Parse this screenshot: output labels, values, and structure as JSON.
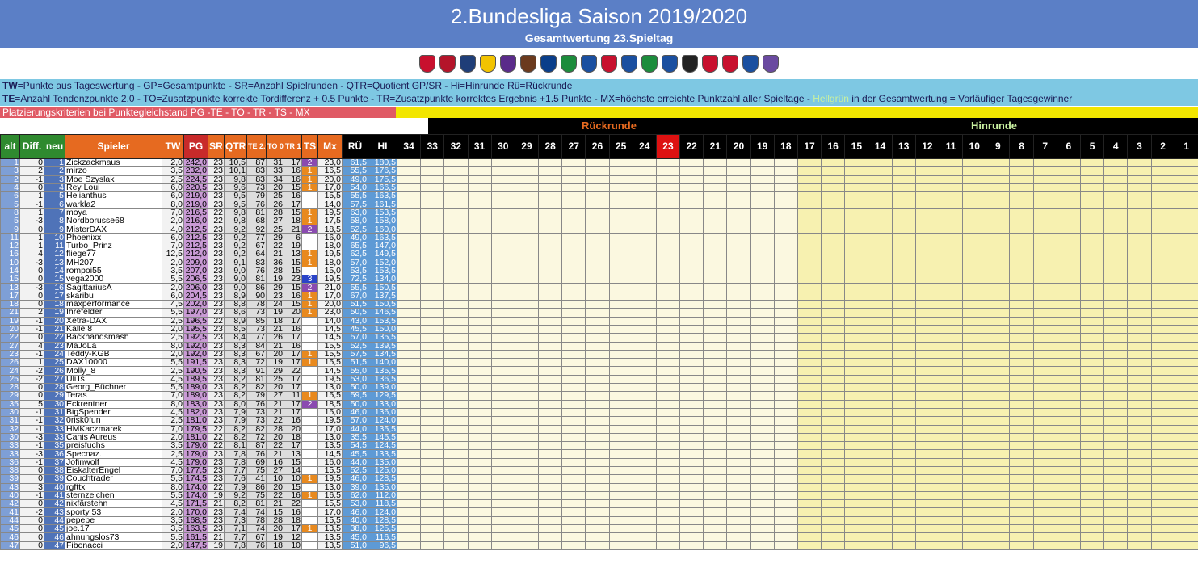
{
  "title": "2.Bundesliga Saison 2019/2020",
  "subtitle": "Gesamtwertung 23.Spieltag",
  "legend_line1": "=Punkte aus Tageswertung - GP=Gesamtpunkte - SR=Anzahl Spielrunden - QTR=Quotient GP/SR - Hi=Hinrunde Rü=Rückrunde",
  "legend_line1_prefix": "TW",
  "legend_line2": "=Anzahl Tendenzpunkte 2.0 - TO=Zusatzpunkte korrekte Tordifferenz + 0.5 Punkte - TR=Zusatzpunkte korrektes Ergebnis +1.5 Punkte - MX=höchste erreichte Punktzahl aller Spieltage - ",
  "legend_line2_prefix": "TE",
  "legend_green": "Hellgrün",
  "legend_tail": " in der Gesamtwertung = Vorläufiger Tagesgewinner",
  "criteria": "Platzierungskriterien bei Punktegleichstand  PG  -TE - TO - TR - TS - MX",
  "section_rueck": "Rückrunde",
  "section_hin": "Hinrunde",
  "headers": {
    "alt": "alt",
    "diff": "Diff.",
    "neu": "neu",
    "spieler": "Spieler",
    "tw": "TW",
    "pg": "PG",
    "sr": "SR",
    "qtr": "QTR",
    "te": "TE 2.0",
    "to": "TO 0.5",
    "tr": "TR 1.5",
    "ts": "TS",
    "mx": "Mx",
    "ru": "RÜ",
    "hi": "HI",
    "rounds_rueck": [
      "34",
      "33",
      "32",
      "31",
      "30",
      "29",
      "28",
      "27",
      "26",
      "25",
      "24",
      "23",
      "22",
      "21",
      "20",
      "19",
      "18"
    ],
    "rounds_hin": [
      "17",
      "16",
      "15",
      "14",
      "13",
      "12",
      "11",
      "10",
      "9",
      "8",
      "7",
      "6",
      "5",
      "4",
      "3",
      "2",
      "1"
    ]
  },
  "team_logos": [
    "1. FC Heidenheim",
    "1. FC Nürnberg",
    "Arminia Bielefeld",
    "Dynamo Dresden",
    "Erzgebirge Aue",
    "FC St. Pauli",
    "Hamburger SV",
    "Hannover 96",
    "Holstein Kiel",
    "Jahn Regensburg",
    "Karlsruher SC",
    "SpVgg Greuther Fürth",
    "SV Darmstadt 98",
    "SV Sandhausen",
    "SV Wehen Wiesbaden",
    "VfB Stuttgart",
    "VfL Bochum",
    "VfL Osnabrück"
  ],
  "rows": [
    [
      "1",
      "0",
      "1",
      "Zickzackmaus",
      "2,0",
      "242,0",
      "23",
      "10,5",
      "87",
      "31",
      "17",
      "2",
      "23,0",
      "61,5",
      "180,5"
    ],
    [
      "3",
      "2",
      "2",
      "mirzo",
      "3,5",
      "232,0",
      "23",
      "10,1",
      "83",
      "33",
      "16",
      "1",
      "16,5",
      "55,5",
      "176,5"
    ],
    [
      "2",
      "-1",
      "3",
      "Moe Szyslak",
      "2,5",
      "224,5",
      "23",
      "9,8",
      "83",
      "34",
      "16",
      "1",
      "20,0",
      "49,0",
      "175,5"
    ],
    [
      "4",
      "0",
      "4",
      "Rey Loui",
      "6,0",
      "220,5",
      "23",
      "9,6",
      "73",
      "20",
      "15",
      "1",
      "17,0",
      "54,0",
      "166,5"
    ],
    [
      "6",
      "1",
      "5",
      "Helianthus",
      "6,0",
      "219,0",
      "23",
      "9,5",
      "79",
      "25",
      "16",
      "",
      "15,5",
      "55,5",
      "163,5"
    ],
    [
      "5",
      "-1",
      "6",
      "warkla2",
      "8,0",
      "219,0",
      "23",
      "9,5",
      "76",
      "26",
      "17",
      "",
      "14,0",
      "57,5",
      "161,5"
    ],
    [
      "8",
      "1",
      "7",
      "moya",
      "7,0",
      "216,5",
      "22",
      "9,8",
      "81",
      "28",
      "15",
      "1",
      "19,5",
      "63,0",
      "153,5"
    ],
    [
      "5",
      "-3",
      "8",
      "Nordborusse68",
      "2,0",
      "216,0",
      "22",
      "9,8",
      "68",
      "27",
      "18",
      "1",
      "17,5",
      "58,0",
      "158,0"
    ],
    [
      "9",
      "0",
      "9",
      "MisterDAX",
      "4,0",
      "212,5",
      "23",
      "9,2",
      "92",
      "25",
      "21",
      "2",
      "18,5",
      "52,5",
      "160,0"
    ],
    [
      "11",
      "1",
      "10",
      "Phoenixx",
      "6,0",
      "212,5",
      "23",
      "9,2",
      "77",
      "29",
      "6",
      "",
      "16,0",
      "49,0",
      "163,5"
    ],
    [
      "12",
      "1",
      "11",
      "Turbo_Prinz",
      "7,0",
      "212,5",
      "23",
      "9,2",
      "67",
      "22",
      "19",
      "",
      "18,0",
      "65,5",
      "147,0"
    ],
    [
      "16",
      "4",
      "12",
      "fliege77",
      "12,5",
      "212,0",
      "23",
      "9,2",
      "64",
      "21",
      "13",
      "1",
      "19,5",
      "62,5",
      "149,5"
    ],
    [
      "10",
      "-3",
      "13",
      "MH207",
      "2,0",
      "209,0",
      "23",
      "9,1",
      "83",
      "36",
      "15",
      "1",
      "18,0",
      "57,0",
      "152,0"
    ],
    [
      "14",
      "0",
      "14",
      "rompoi55",
      "3,5",
      "207,0",
      "23",
      "9,0",
      "76",
      "28",
      "15",
      "",
      "15,0",
      "53,5",
      "153,5"
    ],
    [
      "15",
      "0",
      "15",
      "vega2000",
      "5,5",
      "206,5",
      "23",
      "9,0",
      "81",
      "19",
      "23",
      "3",
      "19,5",
      "72,5",
      "134,0"
    ],
    [
      "13",
      "-3",
      "16",
      "SagittariusA",
      "2,0",
      "206,0",
      "23",
      "9,0",
      "86",
      "29",
      "15",
      "2",
      "21,0",
      "55,5",
      "150,5"
    ],
    [
      "17",
      "0",
      "17",
      "skaribu",
      "6,0",
      "204,5",
      "23",
      "8,9",
      "90",
      "23",
      "16",
      "1",
      "17,0",
      "67,0",
      "137,5"
    ],
    [
      "18",
      "0",
      "18",
      "maxperformance",
      "4,5",
      "202,0",
      "23",
      "8,8",
      "78",
      "24",
      "15",
      "1",
      "20,0",
      "51,5",
      "150,5"
    ],
    [
      "21",
      "2",
      "19",
      "Ihrefelder",
      "5,5",
      "197,0",
      "23",
      "8,6",
      "73",
      "19",
      "20",
      "1",
      "23,0",
      "50,5",
      "146,5"
    ],
    [
      "19",
      "-1",
      "20",
      "Xetra-DAX",
      "2,5",
      "196,5",
      "22",
      "8,9",
      "85",
      "18",
      "17",
      "",
      "14,0",
      "43,0",
      "153,5"
    ],
    [
      "20",
      "-1",
      "21",
      "Kalle 8",
      "2,0",
      "195,5",
      "23",
      "8,5",
      "73",
      "21",
      "16",
      "",
      "14,5",
      "45,5",
      "150,0"
    ],
    [
      "22",
      "0",
      "22",
      "Backhandsmash",
      "2,5",
      "192,5",
      "23",
      "8,4",
      "77",
      "26",
      "17",
      "",
      "14,5",
      "57,0",
      "135,5"
    ],
    [
      "27",
      "4",
      "23",
      "MaJoLa",
      "8,0",
      "192,0",
      "23",
      "8,3",
      "84",
      "21",
      "16",
      "",
      "15,5",
      "52,5",
      "139,5"
    ],
    [
      "23",
      "-1",
      "24",
      "Teddy-KGB",
      "2,0",
      "192,0",
      "23",
      "8,3",
      "67",
      "20",
      "17",
      "1",
      "15,5",
      "57,5",
      "134,5"
    ],
    [
      "26",
      "1",
      "25",
      "DAX10000",
      "5,5",
      "191,5",
      "23",
      "8,3",
      "72",
      "19",
      "17",
      "1",
      "15,5",
      "51,5",
      "140,0"
    ],
    [
      "24",
      "-2",
      "26",
      "Molly_8",
      "2,5",
      "190,5",
      "23",
      "8,3",
      "91",
      "29",
      "22",
      "",
      "14,5",
      "55,0",
      "135,5"
    ],
    [
      "25",
      "-2",
      "27",
      "UliTs",
      "4,5",
      "189,5",
      "23",
      "8,2",
      "81",
      "25",
      "17",
      "",
      "19,5",
      "53,0",
      "136,5"
    ],
    [
      "28",
      "0",
      "28",
      "Georg_Büchner",
      "5,5",
      "189,0",
      "23",
      "8,2",
      "82",
      "20",
      "17",
      "",
      "13,0",
      "50,0",
      "139,0"
    ],
    [
      "29",
      "0",
      "29",
      "Teras",
      "7,0",
      "189,0",
      "23",
      "8,2",
      "79",
      "27",
      "11",
      "1",
      "15,5",
      "59,5",
      "129,5"
    ],
    [
      "35",
      "5",
      "30",
      "Eckrentner",
      "8,0",
      "183,0",
      "23",
      "8,0",
      "76",
      "21",
      "17",
      "2",
      "18,5",
      "50,0",
      "133,0"
    ],
    [
      "30",
      "-1",
      "31",
      "BigSpender",
      "4,5",
      "182,0",
      "23",
      "7,9",
      "73",
      "21",
      "17",
      "",
      "15,0",
      "46,0",
      "136,0"
    ],
    [
      "31",
      "-1",
      "32",
      "0risk0fun",
      "2,5",
      "181,0",
      "23",
      "7,9",
      "73",
      "22",
      "16",
      "",
      "19,5",
      "57,0",
      "124,0"
    ],
    [
      "32",
      "-1",
      "33",
      "HMKaczmarek",
      "7,0",
      "179,5",
      "22",
      "8,2",
      "82",
      "28",
      "20",
      "",
      "17,0",
      "44,0",
      "135,5"
    ],
    [
      "30",
      "-3",
      "33",
      "Canis Aureus",
      "2,0",
      "181,0",
      "22",
      "8,2",
      "72",
      "20",
      "18",
      "",
      "13,0",
      "35,5",
      "145,5"
    ],
    [
      "33",
      "-1",
      "35",
      "preisfuchs",
      "3,5",
      "179,0",
      "22",
      "8,1",
      "87",
      "22",
      "17",
      "",
      "13,5",
      "54,5",
      "124,5"
    ],
    [
      "33",
      "-3",
      "36",
      "Specnaz.",
      "2,5",
      "179,0",
      "23",
      "7,8",
      "76",
      "21",
      "13",
      "",
      "14,5",
      "45,5",
      "133,5"
    ],
    [
      "36",
      "-1",
      "37",
      "Jofinwolf",
      "4,5",
      "179,0",
      "23",
      "7,8",
      "69",
      "16",
      "15",
      "",
      "16,0",
      "44,0",
      "135,0"
    ],
    [
      "38",
      "0",
      "38",
      "EiskalterEngel",
      "7,0",
      "177,5",
      "23",
      "7,7",
      "75",
      "27",
      "14",
      "",
      "15,5",
      "52,5",
      "125,0"
    ],
    [
      "39",
      "0",
      "39",
      "Couchtrader",
      "5,5",
      "174,5",
      "23",
      "7,6",
      "41",
      "10",
      "10",
      "1",
      "19,5",
      "46,0",
      "128,5"
    ],
    [
      "43",
      "3",
      "40",
      "rgfttx",
      "8,0",
      "174,0",
      "22",
      "7,9",
      "86",
      "20",
      "15",
      "",
      "13,0",
      "39,0",
      "135,0"
    ],
    [
      "40",
      "-1",
      "41",
      "sternzeichen",
      "5,5",
      "174,0",
      "19",
      "9,2",
      "75",
      "22",
      "16",
      "1",
      "16,5",
      "62,0",
      "112,0"
    ],
    [
      "42",
      "0",
      "42",
      "nixfärstehn",
      "4,5",
      "171,5",
      "21",
      "8,2",
      "81",
      "21",
      "22",
      "",
      "15,5",
      "53,0",
      "118,5"
    ],
    [
      "41",
      "-2",
      "43",
      "sporty 53",
      "2,0",
      "170,0",
      "23",
      "7,4",
      "74",
      "15",
      "16",
      "",
      "17,0",
      "46,0",
      "124,0"
    ],
    [
      "44",
      "0",
      "44",
      "pepepe",
      "3,5",
      "168,5",
      "23",
      "7,3",
      "78",
      "28",
      "18",
      "",
      "15,5",
      "40,0",
      "128,5"
    ],
    [
      "45",
      "0",
      "45",
      "joe.17",
      "3,5",
      "163,5",
      "23",
      "7,1",
      "74",
      "20",
      "17",
      "1",
      "13,5",
      "38,0",
      "125,5"
    ],
    [
      "46",
      "0",
      "46",
      "ahnungslos73",
      "5,5",
      "161,5",
      "21",
      "7,7",
      "67",
      "19",
      "12",
      "",
      "13,5",
      "45,0",
      "116,5"
    ],
    [
      "47",
      "0",
      "47",
      "Fibonacci",
      "2,0",
      "147,5",
      "19",
      "7,8",
      "76",
      "18",
      "10",
      "",
      "13,5",
      "51,0",
      "96,5"
    ]
  ],
  "colors": {
    "header": "#5b7fc6",
    "legend": "#7ec8e3",
    "criteria": "#e05a65",
    "highlight": "#2f8a2f"
  }
}
